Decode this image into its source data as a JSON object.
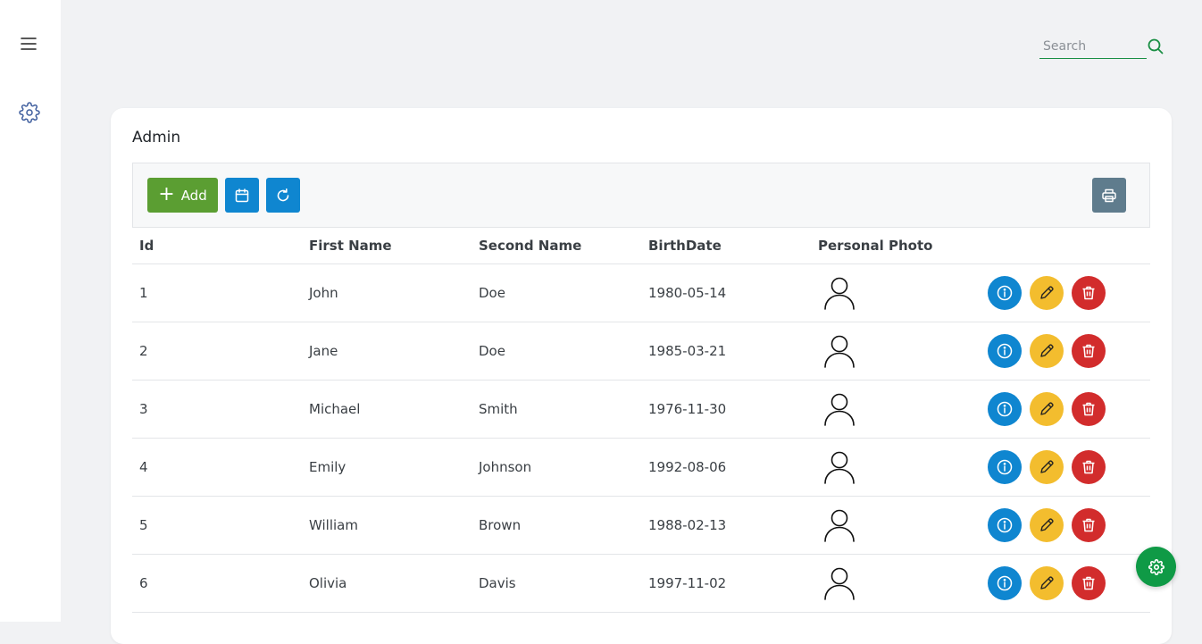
{
  "sidebar": {
    "menu_icon": "hamburger-icon",
    "settings_icon": "gear-icon"
  },
  "search": {
    "placeholder": "Search",
    "value": "",
    "icon": "search-icon",
    "color": "#1a8f44"
  },
  "card": {
    "title": "Admin"
  },
  "toolbar": {
    "add_label": "Add",
    "add_icon": "plus-icon",
    "calendar_icon": "calendar-icon",
    "refresh_icon": "refresh-icon",
    "print_icon": "printer-icon"
  },
  "table": {
    "columns": [
      "Id",
      "First Name",
      "Second Name",
      "BirthDate",
      "Personal Photo"
    ],
    "rows": [
      {
        "id": "1",
        "first": "John",
        "second": "Doe",
        "birth": "1980-05-14"
      },
      {
        "id": "2",
        "first": "Jane",
        "second": "Doe",
        "birth": "1985-03-21"
      },
      {
        "id": "3",
        "first": "Michael",
        "second": "Smith",
        "birth": "1976-11-30"
      },
      {
        "id": "4",
        "first": "Emily",
        "second": "Johnson",
        "birth": "1992-08-06"
      },
      {
        "id": "5",
        "first": "William",
        "second": "Brown",
        "birth": "1988-02-13"
      },
      {
        "id": "6",
        "first": "Olivia",
        "second": "Davis",
        "birth": "1997-11-02"
      }
    ],
    "row_actions": [
      "info-icon",
      "pencil-icon",
      "trash-icon"
    ]
  },
  "colors": {
    "add": "#5b9e32",
    "primary": "#0f86d0",
    "print": "#5f7c8d",
    "edit": "#f3bd2e",
    "delete": "#d22c2c",
    "fab": "#0f9a46"
  },
  "fab_icon": "gear-icon"
}
